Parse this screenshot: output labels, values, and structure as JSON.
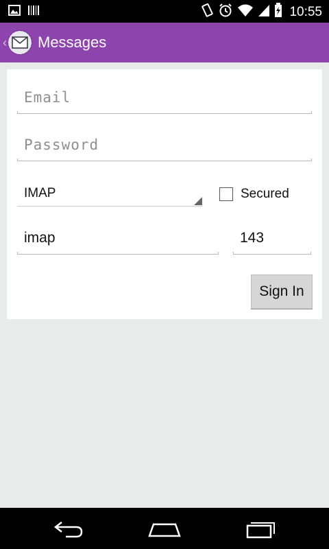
{
  "status_bar": {
    "time": "10:55",
    "icons": [
      "image-icon",
      "barcode-icon",
      "rotate-icon",
      "alarm-icon",
      "wifi-icon",
      "signal-icon",
      "battery-icon"
    ]
  },
  "action_bar": {
    "title": "Messages",
    "color": "#8e44ad",
    "app_icon": "envelope-icon"
  },
  "form": {
    "email_placeholder": "Email",
    "password_placeholder": "Password",
    "protocol": "IMAP",
    "secured_label": "Secured",
    "secured_checked": false,
    "host_value": "imap",
    "port_value": "143",
    "sign_in_label": "Sign In"
  },
  "nav_bar": {
    "icons": [
      "back-icon",
      "home-icon",
      "recent-apps-icon"
    ]
  }
}
